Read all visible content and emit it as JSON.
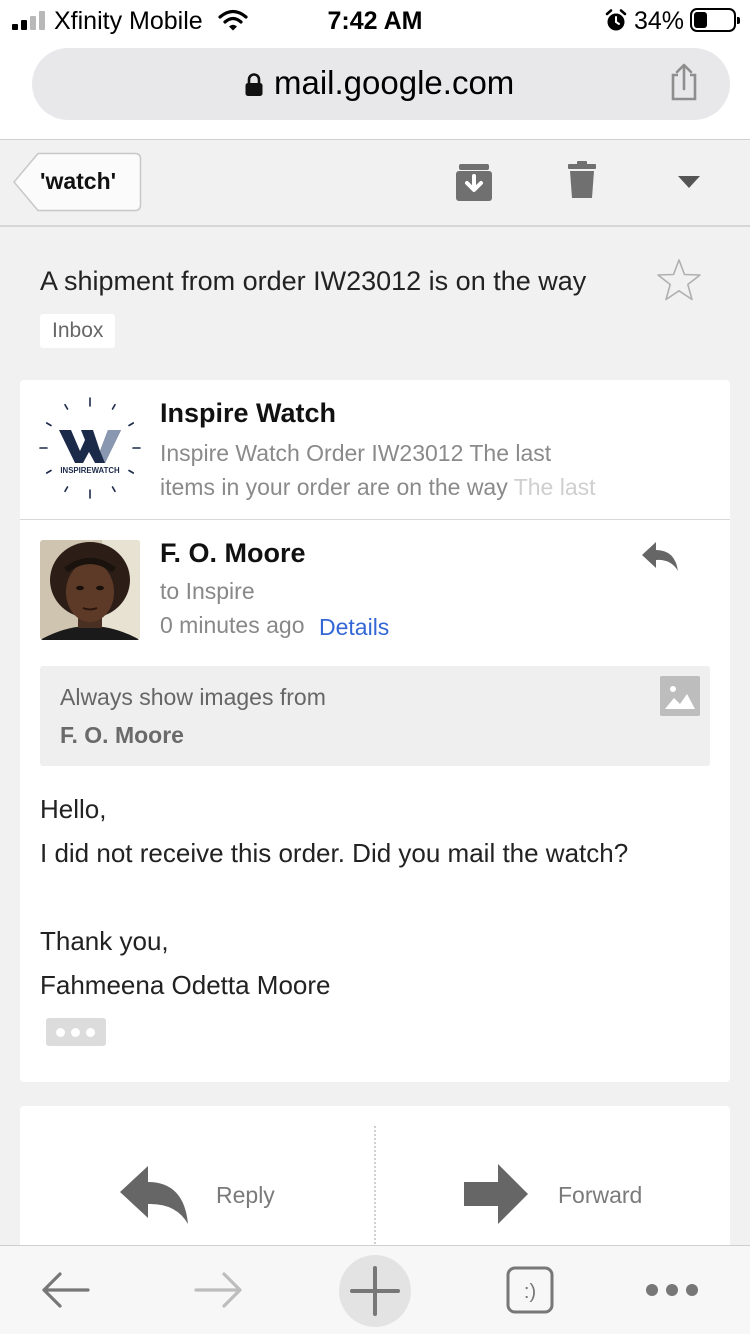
{
  "status_bar": {
    "carrier": "Xfinity Mobile",
    "time": "7:42 AM",
    "battery_percent": "34%",
    "battery_level": 0.34,
    "signal_bars_active": 2,
    "signal_bars_total": 4
  },
  "browser": {
    "url": "mail.google.com"
  },
  "toolbar": {
    "back_label": "'watch'",
    "icons": [
      "archive-icon",
      "trash-icon",
      "dropdown-icon"
    ]
  },
  "thread": {
    "subject": "A shipment from order IW23012 is on the way",
    "label": "Inbox",
    "starred": false
  },
  "collapsed_message": {
    "sender": "Inspire Watch",
    "logo_text": "INSPIREWATCH",
    "snippet_line1": "Inspire Watch Order IW23012 The last",
    "snippet_line2": "items in your order are on the way ",
    "snippet_fade": "The last"
  },
  "message": {
    "sender": "F. O. Moore",
    "recipient": "to Inspire",
    "time": "0 minutes ago",
    "details_link": "Details",
    "images_prompt": "Always show images from",
    "images_sender": "F. O. Moore",
    "body": {
      "greeting": "Hello,",
      "line1": "I did not receive this order. Did you mail the watch?",
      "closing": "Thank you,",
      "signature": "Fahmeena Odetta Moore"
    }
  },
  "actions": {
    "reply": "Reply",
    "forward": "Forward"
  },
  "bottom_bar": {
    "tabs_icon_text": ":)"
  }
}
